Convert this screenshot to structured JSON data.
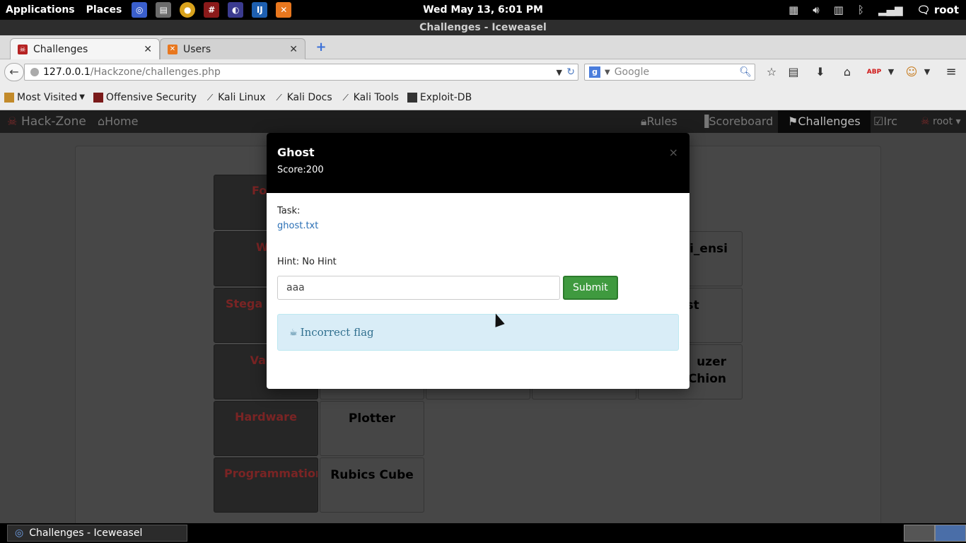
{
  "top_panel": {
    "applications_label": "Applications",
    "places_label": "Places",
    "clock": "Wed May 13,  6:01 PM",
    "user": "root"
  },
  "window": {
    "title": "Challenges - Iceweasel"
  },
  "tabs": [
    {
      "label": "Challenges",
      "active": true
    },
    {
      "label": "Users",
      "active": false
    }
  ],
  "navbar": {
    "url_host": "127.0.0.1",
    "url_path": "/Hackzone/challenges.php",
    "search_placeholder": "Google"
  },
  "bookmarks": [
    {
      "label": "Most Visited",
      "icon": "folder-icon"
    },
    {
      "label": "Offensive Security",
      "icon": "offsec-icon"
    },
    {
      "label": "Kali Linux",
      "icon": "kali-dragon-icon"
    },
    {
      "label": "Kali Docs",
      "icon": "kali-dragon-icon"
    },
    {
      "label": "Kali Tools",
      "icon": "kali-dragon-icon"
    },
    {
      "label": "Exploit-DB",
      "icon": "exploitdb-icon"
    }
  ],
  "site_nav": {
    "brand": "Hack-Zone",
    "home": "Home",
    "rules": "Rules",
    "scoreboard": "Scoreboard",
    "challenges": "Challenges",
    "irc": "Irc",
    "user": "root"
  },
  "categories": [
    "Fore",
    "We",
    "Stega",
    "Valid",
    "Hardware",
    "Programmation"
  ],
  "challenges": {
    "c1": "ni_ensi",
    "c2": "ast",
    "c3": "uzer Chion",
    "c4": "Plotter",
    "c5": "Rubics Cube"
  },
  "modal": {
    "title": "Ghost",
    "score_label": "Score:",
    "score_value": "200",
    "close_glyph": "×",
    "task_label": "Task:",
    "task_file": "ghost.txt",
    "hint_label": "Hint:",
    "hint_value": "No Hint",
    "flag_value": "aaa",
    "submit_label": "Submit",
    "alert_message": "Incorrect flag"
  },
  "taskbar": {
    "window_label": "Challenges - Iceweasel"
  },
  "colors": {
    "modal_header": "#000000",
    "submit_green": "#3f9a3f",
    "alert_bg": "#d9edf7",
    "alert_text": "#31708f",
    "category_text": "#7a2424"
  }
}
